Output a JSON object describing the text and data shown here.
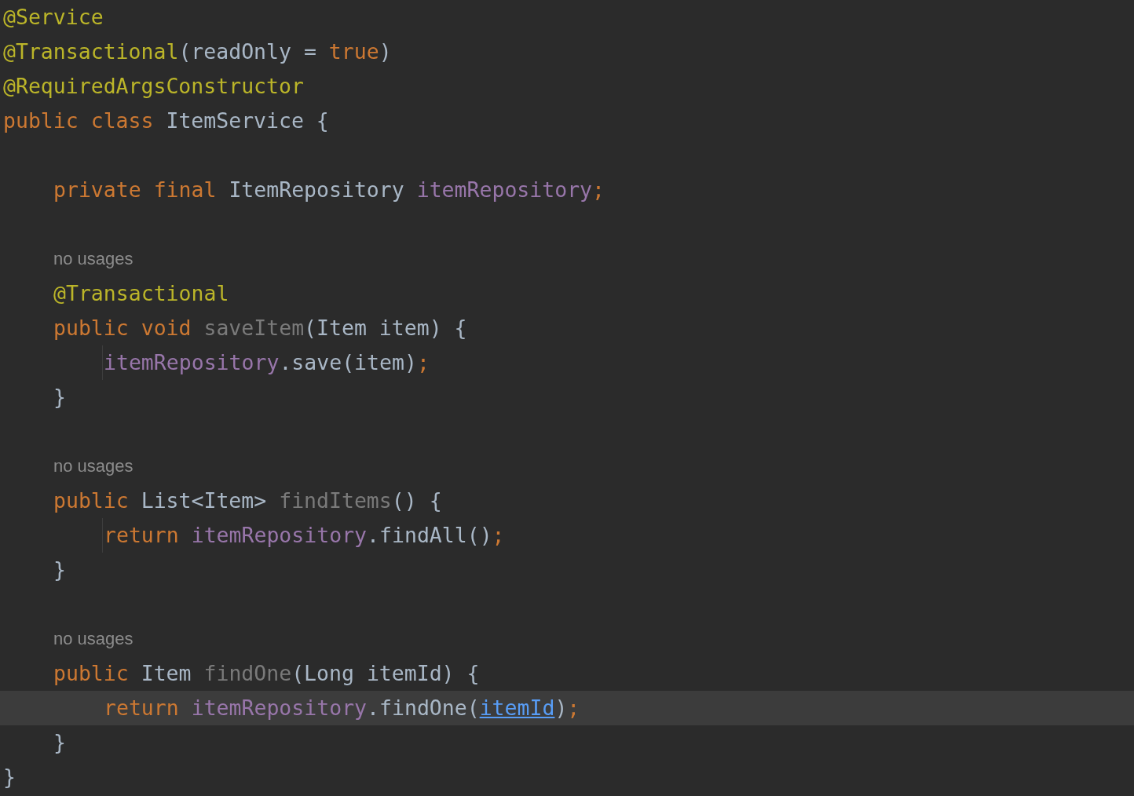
{
  "editor": {
    "lines": [
      {
        "kind": "code",
        "selected": false,
        "tokens": [
          {
            "kind": "annotation",
            "text": "@Service"
          }
        ]
      },
      {
        "kind": "code",
        "selected": false,
        "tokens": [
          {
            "kind": "annotation",
            "text": "@Transactional"
          },
          {
            "kind": "plain",
            "text": "(readOnly = "
          },
          {
            "kind": "keyword",
            "text": "true"
          },
          {
            "kind": "plain",
            "text": ")"
          }
        ]
      },
      {
        "kind": "code",
        "selected": false,
        "tokens": [
          {
            "kind": "annotation",
            "text": "@RequiredArgsConstructor"
          }
        ]
      },
      {
        "kind": "code",
        "selected": false,
        "tokens": [
          {
            "kind": "keyword",
            "text": "public class "
          },
          {
            "kind": "plain",
            "text": "ItemService {"
          }
        ],
        "children": [
          {
            "kind": "blank"
          },
          {
            "kind": "code",
            "selected": false,
            "tokens": [
              {
                "kind": "keyword",
                "text": "private final "
              },
              {
                "kind": "plain",
                "text": "ItemRepository "
              },
              {
                "kind": "field",
                "text": "itemRepository"
              },
              {
                "kind": "keyword",
                "text": ";"
              }
            ]
          },
          {
            "kind": "blank"
          },
          {
            "kind": "hint",
            "text": "no usages"
          },
          {
            "kind": "code",
            "selected": false,
            "tokens": [
              {
                "kind": "annotation",
                "text": "@Transactional"
              }
            ]
          },
          {
            "kind": "code",
            "selected": false,
            "tokens": [
              {
                "kind": "keyword",
                "text": "public void "
              },
              {
                "kind": "unused",
                "text": "saveItem"
              },
              {
                "kind": "plain",
                "text": "(Item item) {"
              }
            ],
            "children": [
              {
                "kind": "code",
                "selected": false,
                "tokens": [
                  {
                    "kind": "field",
                    "text": "itemRepository"
                  },
                  {
                    "kind": "plain",
                    "text": ".save(item)"
                  },
                  {
                    "kind": "keyword",
                    "text": ";"
                  }
                ]
              }
            ]
          },
          {
            "kind": "code",
            "selected": false,
            "tokens": [
              {
                "kind": "plain",
                "text": "}"
              }
            ]
          },
          {
            "kind": "blank"
          },
          {
            "kind": "hint",
            "text": "no usages"
          },
          {
            "kind": "code",
            "selected": false,
            "tokens": [
              {
                "kind": "keyword",
                "text": "public "
              },
              {
                "kind": "plain",
                "text": "List<Item> "
              },
              {
                "kind": "unused",
                "text": "findItems"
              },
              {
                "kind": "plain",
                "text": "() {"
              }
            ],
            "children": [
              {
                "kind": "code",
                "selected": false,
                "tokens": [
                  {
                    "kind": "keyword",
                    "text": "return "
                  },
                  {
                    "kind": "field",
                    "text": "itemRepository"
                  },
                  {
                    "kind": "plain",
                    "text": ".findAll()"
                  },
                  {
                    "kind": "keyword",
                    "text": ";"
                  }
                ]
              }
            ]
          },
          {
            "kind": "code",
            "selected": false,
            "tokens": [
              {
                "kind": "plain",
                "text": "}"
              }
            ]
          },
          {
            "kind": "blank"
          },
          {
            "kind": "hint",
            "text": "no usages"
          },
          {
            "kind": "code",
            "selected": false,
            "tokens": [
              {
                "kind": "keyword",
                "text": "public "
              },
              {
                "kind": "plain",
                "text": "Item "
              },
              {
                "kind": "unused",
                "text": "findOne"
              },
              {
                "kind": "plain",
                "text": "(Long itemId) {"
              }
            ],
            "children": [
              {
                "kind": "code",
                "selected": true,
                "tokens": [
                  {
                    "kind": "keyword",
                    "text": "return "
                  },
                  {
                    "kind": "field",
                    "text": "itemRepository"
                  },
                  {
                    "kind": "plain",
                    "text": ".findOne("
                  },
                  {
                    "kind": "link",
                    "text": "itemId"
                  },
                  {
                    "kind": "plain",
                    "text": ")"
                  },
                  {
                    "kind": "keyword",
                    "text": ";"
                  }
                ]
              }
            ]
          },
          {
            "kind": "code",
            "selected": false,
            "tokens": [
              {
                "kind": "plain",
                "text": "}"
              }
            ]
          }
        ]
      },
      {
        "kind": "code",
        "selected": false,
        "tokens": [
          {
            "kind": "plain",
            "text": "}"
          }
        ]
      }
    ]
  }
}
